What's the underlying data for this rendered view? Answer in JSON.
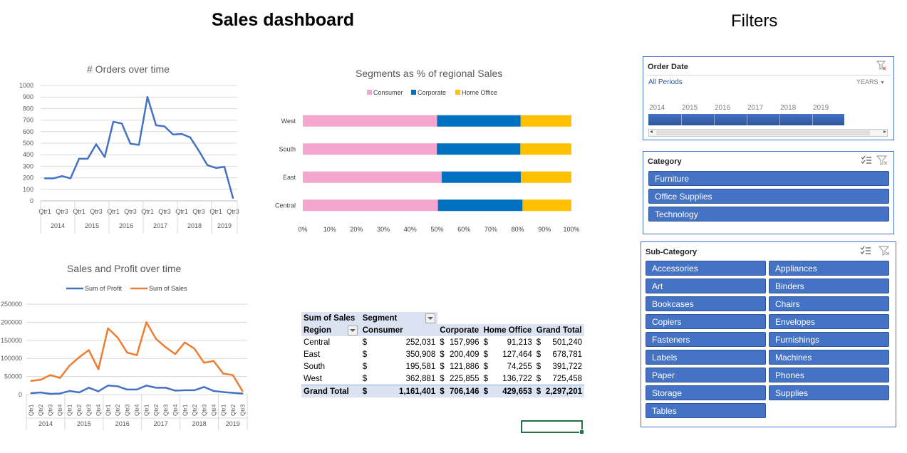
{
  "dashboard": {
    "title": "Sales dashboard",
    "filters_title": "Filters"
  },
  "chart_data": [
    {
      "id": "orders",
      "type": "line",
      "title": "# Orders over time",
      "ylim": [
        0,
        1000
      ],
      "yticks": [
        0,
        100,
        200,
        300,
        400,
        500,
        600,
        700,
        800,
        900,
        1000
      ],
      "quarter_labels": [
        "Qtr1",
        "",
        "Qtr3",
        "",
        "Qtr1",
        "",
        "Qtr3",
        "",
        "Qtr1",
        "",
        "Qtr3",
        "",
        "Qtr1",
        "",
        "Qtr3",
        "",
        "Qtr1",
        "",
        "Qtr3",
        "",
        "Qtr1",
        "",
        "Qtr3"
      ],
      "years": [
        "2014",
        "2015",
        "2016",
        "2017",
        "2018",
        "2019"
      ],
      "series": [
        {
          "color": "#4472c4",
          "values": [
            195,
            195,
            215,
            195,
            365,
            365,
            490,
            380,
            685,
            670,
            495,
            485,
            900,
            655,
            645,
            575,
            580,
            550,
            435,
            310,
            285,
            295,
            25
          ]
        }
      ],
      "grid": true
    },
    {
      "id": "segments",
      "type": "bar",
      "title": "Segments as % of regional Sales",
      "categories": [
        "West",
        "South",
        "East",
        "Central"
      ],
      "xticks": [
        "0%",
        "10%",
        "20%",
        "30%",
        "40%",
        "50%",
        "60%",
        "70%",
        "80%",
        "90%",
        "100%"
      ],
      "legend_position": "top",
      "series": [
        {
          "name": "Consumer",
          "color": "#f4a6ce",
          "values": [
            50.0,
            49.9,
            51.7,
            50.3
          ]
        },
        {
          "name": "Corporate",
          "color": "#0070c0",
          "values": [
            31.1,
            31.1,
            29.5,
            31.5
          ]
        },
        {
          "name": "Home Office",
          "color": "#ffc000",
          "values": [
            18.9,
            19.0,
            18.8,
            18.2
          ]
        }
      ]
    },
    {
      "id": "sales_profit",
      "type": "line",
      "title": "Sales and Profit over time",
      "ylim": [
        0,
        250000
      ],
      "yticks": [
        "0",
        "50000",
        "100000",
        "150000",
        "200000",
        "250000"
      ],
      "quarter_labels": [
        "Qtr1",
        "Qtr2",
        "Qtr3",
        "Qtr4",
        "Qtr1",
        "Qtr2",
        "Qtr3",
        "Qtr4",
        "Qtr1",
        "Qtr2",
        "Qtr3",
        "Qtr4",
        "Qtr1",
        "Qtr2",
        "Qtr3",
        "Qtr4",
        "Qtr1",
        "Qtr2",
        "Qtr3",
        "Qtr4",
        "Qtr1",
        "Qtr2",
        "Qtr3"
      ],
      "years": [
        "2014",
        "2015",
        "2016",
        "2017",
        "2018",
        "2019"
      ],
      "legend_position": "top",
      "series": [
        {
          "name": "Sum of Profit",
          "color": "#4472c4",
          "values": [
            4000,
            6000,
            2000,
            3000,
            10000,
            6000,
            19000,
            9000,
            25000,
            23000,
            14000,
            14000,
            25000,
            19000,
            19000,
            11000,
            12000,
            12000,
            21000,
            10000,
            7000,
            5000,
            3000
          ]
        },
        {
          "name": "Sum of Sales",
          "color": "#ed7d31",
          "values": [
            38000,
            41000,
            54000,
            46000,
            80000,
            103000,
            123000,
            70000,
            183000,
            158000,
            116000,
            109000,
            200000,
            154000,
            131000,
            112000,
            144000,
            127000,
            88000,
            93000,
            58000,
            54000,
            10000
          ]
        }
      ],
      "grid": true
    }
  ],
  "pivot": {
    "header": {
      "sum_label": "Sum of Sales",
      "segment_label": "Segment",
      "region_label": "Region"
    },
    "columns": [
      "Consumer",
      "Corporate",
      "Home Office",
      "Grand Total"
    ],
    "currency": "$",
    "rows": [
      {
        "region": "Central",
        "values": [
          "252,031",
          "157,996",
          "91,213",
          "501,240"
        ]
      },
      {
        "region": "East",
        "values": [
          "350,908",
          "200,409",
          "127,464",
          "678,781"
        ]
      },
      {
        "region": "South",
        "values": [
          "195,581",
          "121,886",
          "74,255",
          "391,722"
        ]
      },
      {
        "region": "West",
        "values": [
          "362,881",
          "225,855",
          "136,722",
          "725,458"
        ]
      }
    ],
    "total": {
      "region": "Grand Total",
      "values": [
        "1,161,401",
        "706,146",
        "429,653",
        "2,297,201"
      ]
    }
  },
  "slicers": {
    "order_date": {
      "title": "Order Date",
      "all_periods": "All Periods",
      "level": "YEARS",
      "years": [
        "2014",
        "2015",
        "2016",
        "2017",
        "2018",
        "2019"
      ]
    },
    "category": {
      "title": "Category",
      "items": [
        "Furniture",
        "Office Supplies",
        "Technology"
      ]
    },
    "sub_category": {
      "title": "Sub-Category",
      "items": [
        "Accessories",
        "Appliances",
        "Art",
        "Binders",
        "Bookcases",
        "Chairs",
        "Copiers",
        "Envelopes",
        "Fasteners",
        "Furnishings",
        "Labels",
        "Machines",
        "Paper",
        "Phones",
        "Storage",
        "Supplies",
        "Tables"
      ]
    }
  },
  "icons": {
    "clear_filter": "clear-filter-icon",
    "multi_select": "multi-select-icon"
  }
}
